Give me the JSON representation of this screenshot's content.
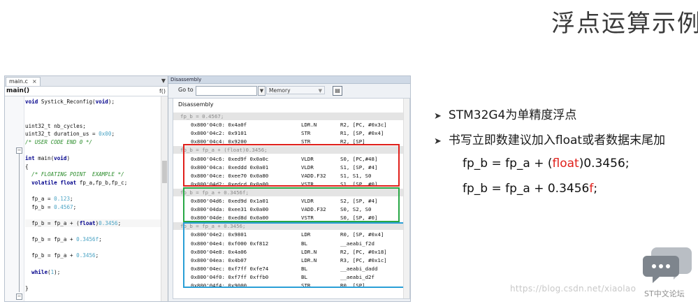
{
  "slide": {
    "title": "浮点运算示例",
    "bullets": [
      "STM32G4为单精度浮点",
      "书写立即数建议加入float或者数据末尾加"
    ],
    "formula1": {
      "a": "fp_b = fp_a + (",
      "b": "float",
      "c": ")0.3456;"
    },
    "formula2": {
      "a": "fp_b = fp_a + 0.3456",
      "b": "f",
      "c": ";"
    }
  },
  "ide": {
    "editor_tab": "main.c",
    "tab_close": "×",
    "tabbar_dropdown": "▼",
    "function_selector": "main()",
    "function_icon": "f()",
    "disasm_title": "Disassembly",
    "goto_label": "Go to",
    "memory_select": "Memory",
    "disasm_header": "Disassembly",
    "highlight_colors": {
      "box1": "#e0201b",
      "box2": "#28a745",
      "box3": "#2a9fd6"
    }
  },
  "code_lines": [
    "void Systick_Reconfig(void);",
    "",
    "",
    "uint32_t nb_cycles;",
    "uint32_t duration_us = 0x00;",
    "/* USER CODE END 0 */",
    "",
    "int main(void)",
    "{",
    "  /* FLOATING POINT  EXAMPLE */",
    "  volatile float fp_a,fp_b,fp_c;",
    "",
    "  fp_a = 0.123;",
    "  fp_b = 0.4567;",
    "",
    "  fp_b = fp_a + (float)0.3456;",
    "",
    "  fp_b = fp_a + 0.3456f;",
    "",
    "  fp_b = fp_a + 0.3456;",
    "",
    "  while(1);",
    "",
    "}"
  ],
  "disasm_lines": [
    {
      "src": "fp_b = 0.4567;"
    },
    {
      "addr": "0x800'04c0: 0x4a0f",
      "mn": "LDR.N",
      "op": "R2, [PC, #0x3c]"
    },
    {
      "addr": "0x800'04c2: 0x9101",
      "mn": "STR",
      "op": "R1, [SP, #0x4]"
    },
    {
      "addr": "0x800'04c4: 0x9200",
      "mn": "STR",
      "op": "R2, [SP]"
    },
    {
      "src": "fp_b = fp_a + (float)0.3456;"
    },
    {
      "addr": "0x800'04c6: 0xed9f 0x0a0c",
      "mn": "VLDR",
      "op": "S0, [PC,#48]"
    },
    {
      "addr": "0x800'04ca: 0xeddd 0x0a01",
      "mn": "VLDR",
      "op": "S1, [SP, #4]"
    },
    {
      "addr": "0x800'04ce: 0xee70 0x0a80",
      "mn": "VADD.F32",
      "op": "S1, S1, S0"
    },
    {
      "addr": "0x800'04d2: 0xedcd 0x0a00",
      "mn": "VSTR",
      "op": "S1, [SP, #0]"
    },
    {
      "src": "fp_b = fp_a + 0.3456f;"
    },
    {
      "addr": "0x800'04d6: 0xed9d 0x1a01",
      "mn": "VLDR",
      "op": "S2, [SP, #4]"
    },
    {
      "addr": "0x800'04da: 0xee31 0x0a00",
      "mn": "VADD.F32",
      "op": "S0, S2, S0"
    },
    {
      "addr": "0x800'04de: 0xed8d 0x0a00",
      "mn": "VSTR",
      "op": "S0, [SP, #0]"
    },
    {
      "src": "fp_b = fp_a + 0.3456;"
    },
    {
      "addr": "0x800'04e2: 0x9801",
      "mn": "LDR",
      "op": "R0, [SP, #0x4]"
    },
    {
      "addr": "0x800'04e4: 0xf000 0xf812",
      "mn": "BL",
      "op": "__aeabi_f2d"
    },
    {
      "addr": "0x800'04e8: 0x4a06",
      "mn": "LDR.N",
      "op": "R2, [PC, #0x18]"
    },
    {
      "addr": "0x800'04ea: 0x4b07",
      "mn": "LDR.N",
      "op": "R3, [PC, #0x1c]"
    },
    {
      "addr": "0x800'04ec: 0xf7ff 0xfe74",
      "mn": "BL",
      "op": "__aeabi_dadd"
    },
    {
      "addr": "0x800'04f0: 0xf7ff 0xffb0",
      "mn": "BL",
      "op": "__aeabi_d2f"
    },
    {
      "addr": "0x800'04f4: 0x9000",
      "mn": "STR",
      "op": "R0, [SP]"
    }
  ],
  "watermark": {
    "url": "https://blog.csdn.net/xiaolao",
    "caption": "ST中文论坛"
  }
}
